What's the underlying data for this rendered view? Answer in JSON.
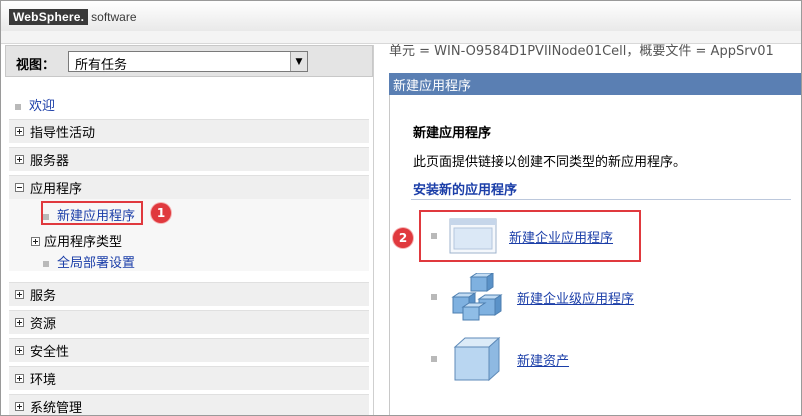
{
  "header": {
    "brand": "WebSphere.",
    "product": "software"
  },
  "nav": {
    "view_label": "视图：",
    "view_value": "所有任务",
    "welcome": "欢迎",
    "sections": [
      {
        "label": "指导性活动",
        "expanded": false
      },
      {
        "label": "服务器",
        "expanded": false
      },
      {
        "label": "应用程序",
        "expanded": true
      },
      {
        "label": "服务",
        "expanded": false
      },
      {
        "label": "资源",
        "expanded": false
      },
      {
        "label": "安全性",
        "expanded": false
      },
      {
        "label": "环境",
        "expanded": false
      },
      {
        "label": "系统管理",
        "expanded": false
      }
    ],
    "app_children": {
      "new_app": "新建应用程序",
      "app_types": "应用程序类型",
      "global_deploy": "全局部署设置"
    }
  },
  "main": {
    "breadcrumb": "单元 = WIN-O9584D1PVIINode01Cell，概要文件 = AppSrv01",
    "panel_header": "新建应用程序",
    "title": "新建应用程序",
    "description": "此页面提供链接以创建不同类型的新应用程序。",
    "section_title": "安装新的应用程序",
    "entries": [
      {
        "label": "新建企业应用程序",
        "icon": "window-icon"
      },
      {
        "label": "新建企业级应用程序",
        "icon": "cubes-icon"
      },
      {
        "label": "新建资产",
        "icon": "cube-icon"
      }
    ]
  },
  "annotations": {
    "badge1": "1",
    "badge2": "2",
    "highlight_color": "#e0393e"
  },
  "colors": {
    "panel_header_bg": "#5a7fb3",
    "link": "#1b3ea8"
  }
}
